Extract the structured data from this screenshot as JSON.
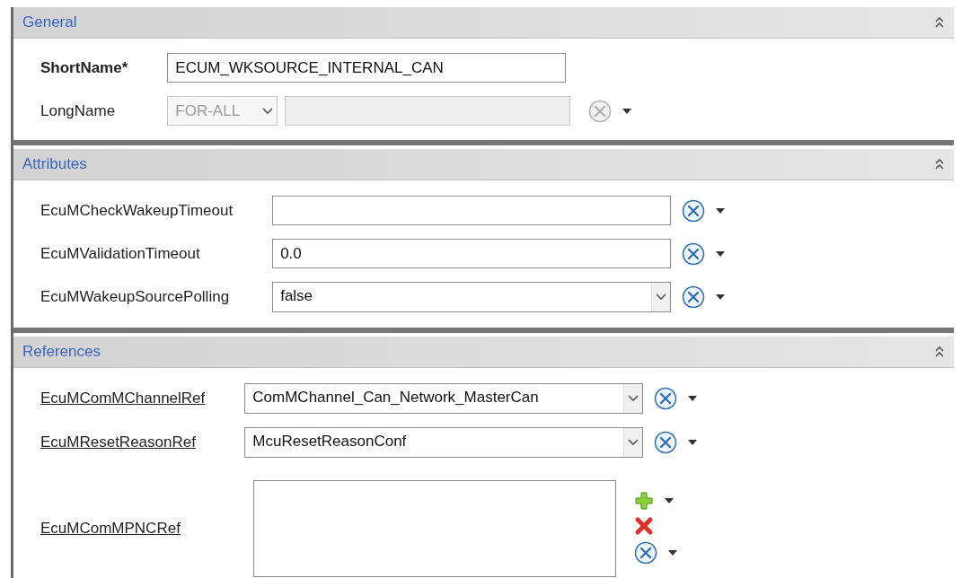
{
  "sections": [
    {
      "title": "General",
      "fields": [
        {
          "kind": "text",
          "label": "ShortName*",
          "required": true,
          "value": "ECUM_WKSOURCE_INTERNAL_CAN"
        },
        {
          "kind": "language",
          "label": "LongName",
          "required": false,
          "disabled": true,
          "language": "FOR-ALL"
        }
      ]
    },
    {
      "title": "Attributes",
      "fields": [
        {
          "kind": "text",
          "label": "EcuMCheckWakeupTimeout",
          "required": false
        },
        {
          "kind": "text",
          "label": "EcuMValidationTimeout",
          "required": false,
          "value": "0.0"
        },
        {
          "kind": "choice",
          "label": "EcuMWakeupSourcePolling",
          "required": false,
          "value": "false"
        }
      ]
    },
    {
      "title": "References",
      "fields": [
        {
          "kind": "reference",
          "label": "EcuMComMChannelRef",
          "required": false,
          "value": "ComMChannel_Can_Network_MasterCan"
        },
        {
          "kind": "reference",
          "label": "EcuMResetReasonRef",
          "required": false,
          "value": "McuResetReasonConf"
        },
        {
          "kind": "reference-list",
          "label": "EcuMComMPNCRef",
          "required": false
        }
      ]
    }
  ]
}
